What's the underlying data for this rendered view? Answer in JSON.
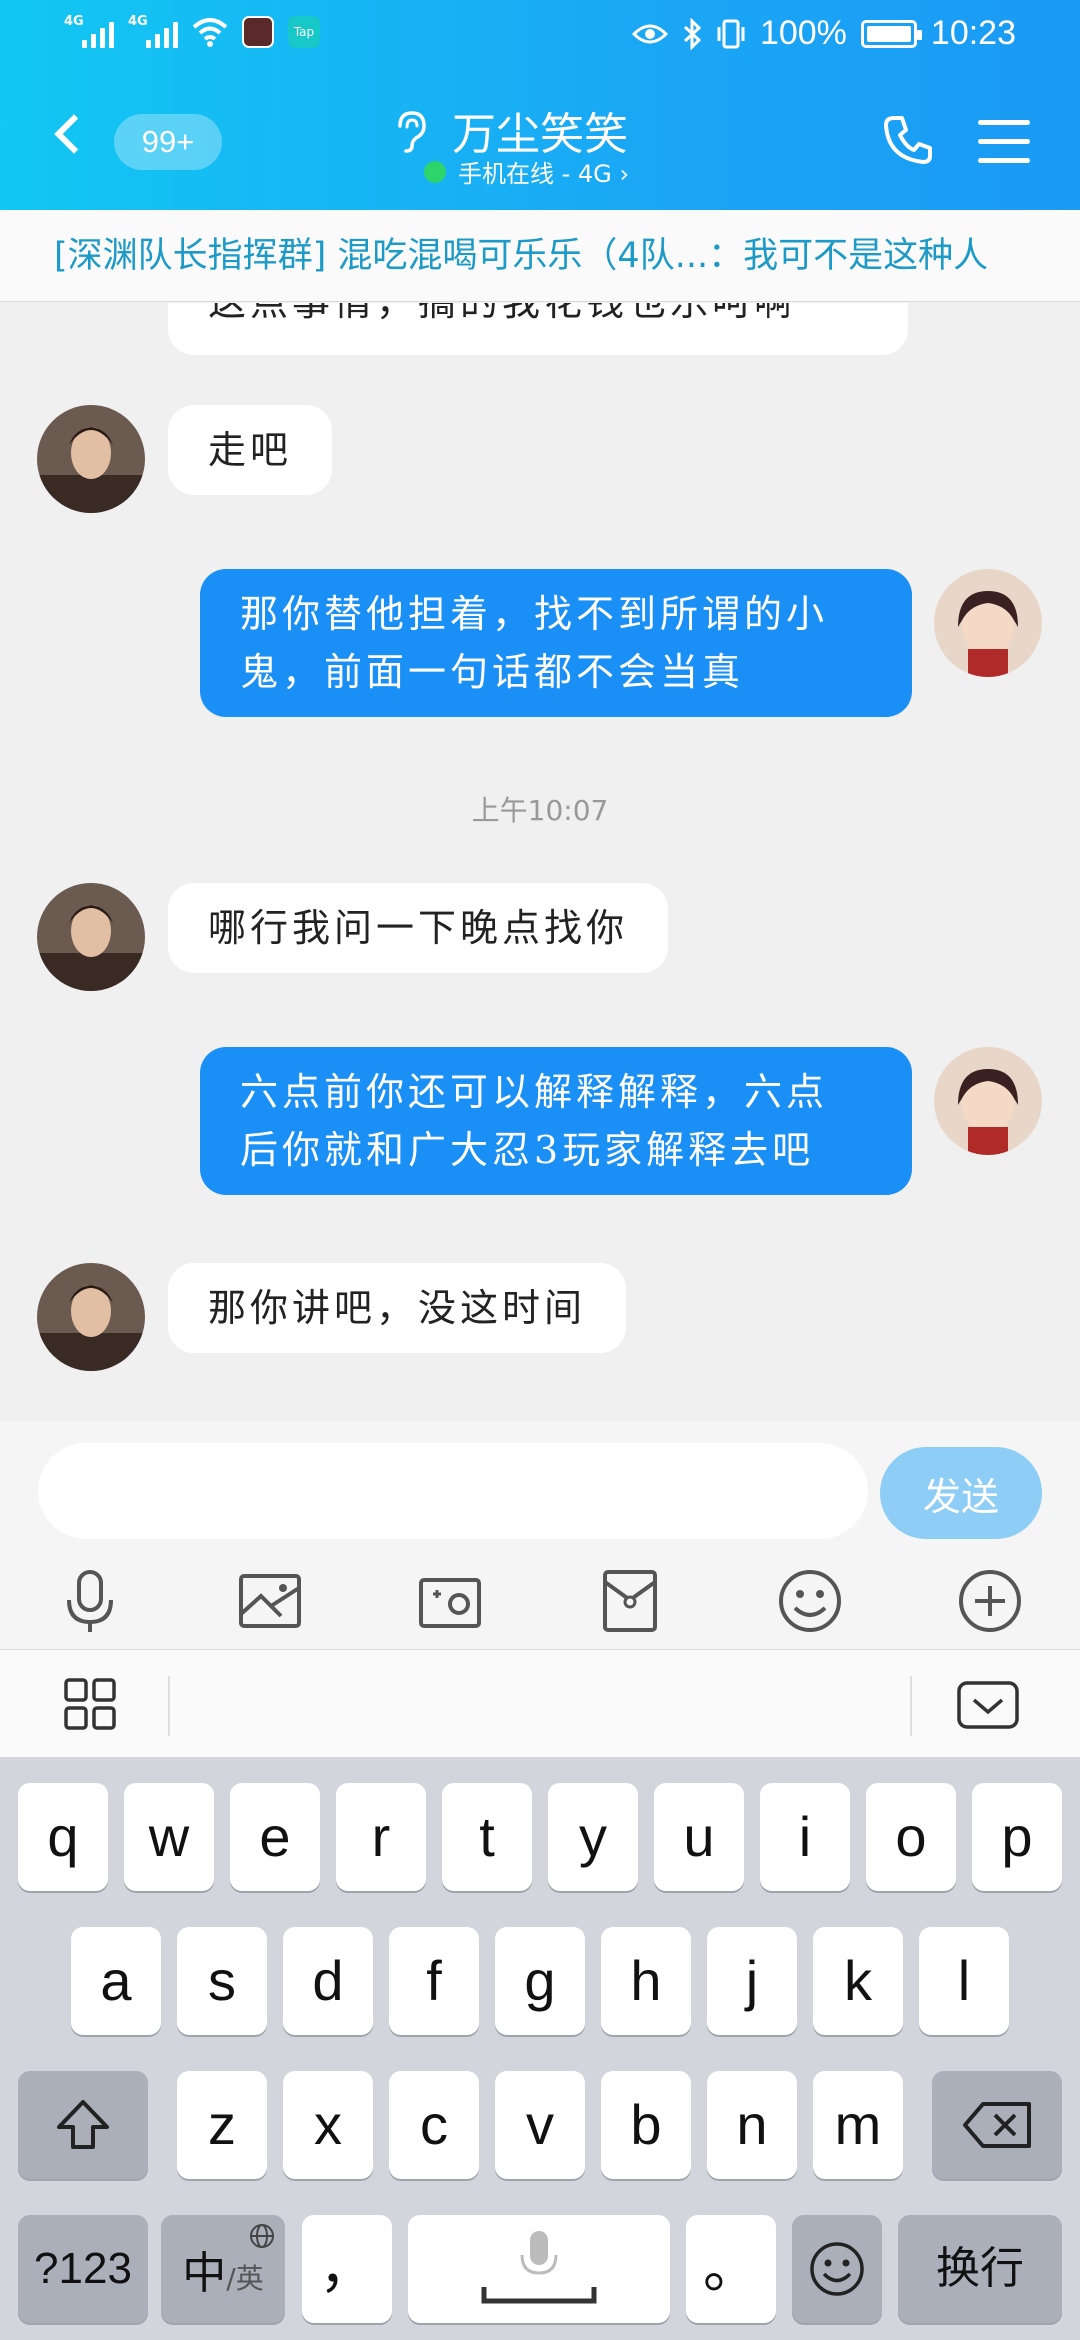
{
  "status_bar": {
    "left_indicators": [
      "4G",
      "4G"
    ],
    "tap_badge": "Tap",
    "battery_text": "100%",
    "time": "10:23"
  },
  "header": {
    "unread_count": "99+",
    "contact_name": "万尘笑笑",
    "status_text": "手机在线 - 4G",
    "status_chevron": "›"
  },
  "group_banner": {
    "text": "[深渊队长指挥群] 混吃混喝可乐乐（4队...：我可不是这种人"
  },
  "messages": [
    {
      "side": "in",
      "text": "这点事情，搞的我花钱也乐呵啊",
      "partial": true
    },
    {
      "side": "in",
      "text": "走吧"
    },
    {
      "side": "out",
      "lines": [
        "那你替他担着，找不到所谓的小",
        "鬼，前面一句话都不会当真"
      ]
    },
    {
      "side": "time",
      "text": "上午10:07"
    },
    {
      "side": "in",
      "text": "哪行我问一下晚点找你"
    },
    {
      "side": "out",
      "lines": [
        "六点前你还可以解释解释，六点",
        "后你就和广大忍3玩家解释去吧"
      ]
    },
    {
      "side": "in",
      "text": "那你讲吧，没这时间"
    }
  ],
  "composer": {
    "placeholder": "",
    "send_label": "发送",
    "tools": [
      "microphone-icon",
      "image-icon",
      "camera-icon",
      "red-packet-icon",
      "emoji-icon",
      "plus-icon"
    ]
  },
  "keyboard": {
    "row1": [
      "q",
      "w",
      "e",
      "r",
      "t",
      "y",
      "u",
      "i",
      "o",
      "p"
    ],
    "row2": [
      "a",
      "s",
      "d",
      "f",
      "g",
      "h",
      "j",
      "k",
      "l"
    ],
    "row3": [
      "z",
      "x",
      "c",
      "v",
      "b",
      "n",
      "m"
    ],
    "numbers_key": "?123",
    "lang_key_main": "中",
    "lang_key_sub": "/英",
    "comma_key": "，",
    "period_key": "。",
    "enter_key": "换行"
  },
  "colors": {
    "header_start": "#12c7f3",
    "header_end": "#1a9af5",
    "outgoing_bubble": "#1a8ff5",
    "banner_text": "#1d9ac8",
    "send_button": "#8dcdf6"
  }
}
